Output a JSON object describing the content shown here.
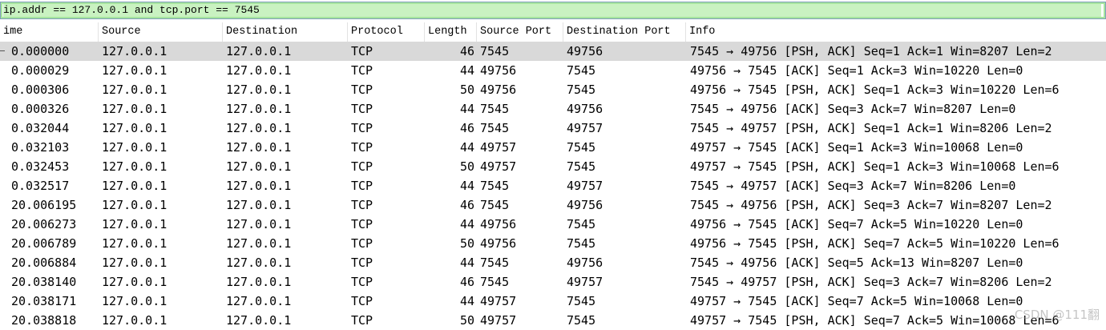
{
  "filter": {
    "value": "ip.addr == 127.0.0.1 and tcp.port == 7545"
  },
  "columns": [
    "ime",
    "Source",
    "Destination",
    "Protocol",
    "Length",
    "Source Port",
    "Destination Port",
    "Info"
  ],
  "rows": [
    [
      "0.000000",
      "127.0.0.1",
      "127.0.0.1",
      "TCP",
      "46",
      "7545",
      "49756",
      "7545 → 49756 [PSH, ACK] Seq=1 Ack=1 Win=8207 Len=2"
    ],
    [
      "0.000029",
      "127.0.0.1",
      "127.0.0.1",
      "TCP",
      "44",
      "49756",
      "7545",
      "49756 → 7545 [ACK] Seq=1 Ack=3 Win=10220 Len=0"
    ],
    [
      "0.000306",
      "127.0.0.1",
      "127.0.0.1",
      "TCP",
      "50",
      "49756",
      "7545",
      "49756 → 7545 [PSH, ACK] Seq=1 Ack=3 Win=10220 Len=6"
    ],
    [
      "0.000326",
      "127.0.0.1",
      "127.0.0.1",
      "TCP",
      "44",
      "7545",
      "49756",
      "7545 → 49756 [ACK] Seq=3 Ack=7 Win=8207 Len=0"
    ],
    [
      "0.032044",
      "127.0.0.1",
      "127.0.0.1",
      "TCP",
      "46",
      "7545",
      "49757",
      "7545 → 49757 [PSH, ACK] Seq=1 Ack=1 Win=8206 Len=2"
    ],
    [
      "0.032103",
      "127.0.0.1",
      "127.0.0.1",
      "TCP",
      "44",
      "49757",
      "7545",
      "49757 → 7545 [ACK] Seq=1 Ack=3 Win=10068 Len=0"
    ],
    [
      "0.032453",
      "127.0.0.1",
      "127.0.0.1",
      "TCP",
      "50",
      "49757",
      "7545",
      "49757 → 7545 [PSH, ACK] Seq=1 Ack=3 Win=10068 Len=6"
    ],
    [
      "0.032517",
      "127.0.0.1",
      "127.0.0.1",
      "TCP",
      "44",
      "7545",
      "49757",
      "7545 → 49757 [ACK] Seq=3 Ack=7 Win=8206 Len=0"
    ],
    [
      "20.006195",
      "127.0.0.1",
      "127.0.0.1",
      "TCP",
      "46",
      "7545",
      "49756",
      "7545 → 49756 [PSH, ACK] Seq=3 Ack=7 Win=8207 Len=2"
    ],
    [
      "20.006273",
      "127.0.0.1",
      "127.0.0.1",
      "TCP",
      "44",
      "49756",
      "7545",
      "49756 → 7545 [ACK] Seq=7 Ack=5 Win=10220 Len=0"
    ],
    [
      "20.006789",
      "127.0.0.1",
      "127.0.0.1",
      "TCP",
      "50",
      "49756",
      "7545",
      "49756 → 7545 [PSH, ACK] Seq=7 Ack=5 Win=10220 Len=6"
    ],
    [
      "20.006884",
      "127.0.0.1",
      "127.0.0.1",
      "TCP",
      "44",
      "7545",
      "49756",
      "7545 → 49756 [ACK] Seq=5 Ack=13 Win=8207 Len=0"
    ],
    [
      "20.038140",
      "127.0.0.1",
      "127.0.0.1",
      "TCP",
      "46",
      "7545",
      "49757",
      "7545 → 49757 [PSH, ACK] Seq=3 Ack=7 Win=8206 Len=2"
    ],
    [
      "20.038171",
      "127.0.0.1",
      "127.0.0.1",
      "TCP",
      "44",
      "49757",
      "7545",
      "49757 → 7545 [ACK] Seq=7 Ack=5 Win=10068 Len=0"
    ],
    [
      "20.038818",
      "127.0.0.1",
      "127.0.0.1",
      "TCP",
      "50",
      "49757",
      "7545",
      "49757 → 7545 [PSH, ACK] Seq=7 Ack=5 Win=10068 Len=6"
    ]
  ],
  "watermark": "CSDN @111翻",
  "colors": {
    "filter_bg": "#c9f2c1",
    "selected_row": "#d9d9d9"
  }
}
